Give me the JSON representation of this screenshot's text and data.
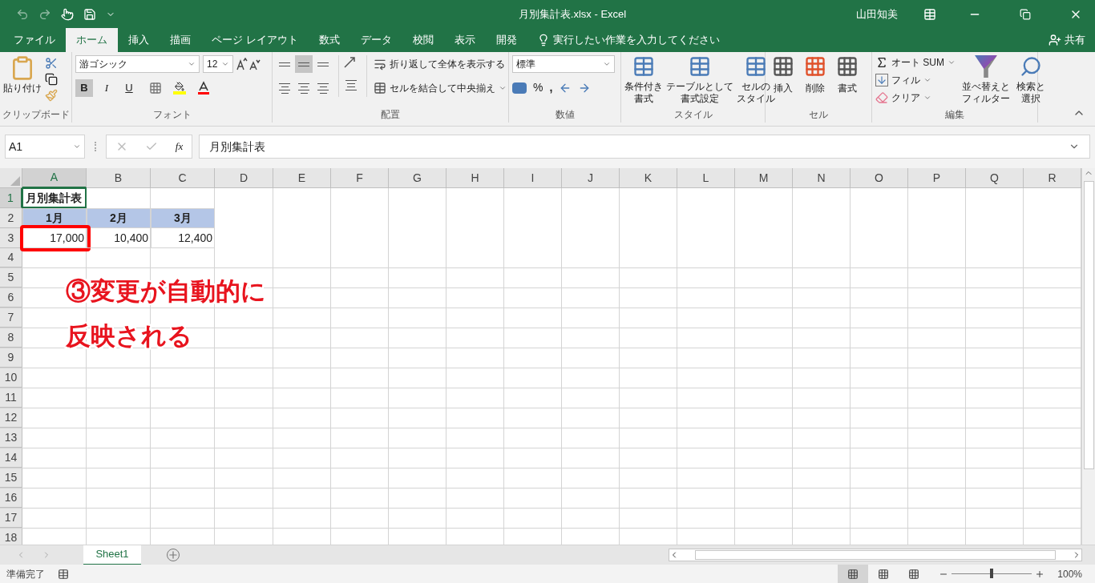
{
  "title_bar": {
    "document": "月別集計表.xlsx - Excel",
    "user": "山田知美"
  },
  "ribbon_tabs": [
    {
      "label": "ファイル",
      "selected": false
    },
    {
      "label": "ホーム",
      "selected": true
    },
    {
      "label": "挿入",
      "selected": false
    },
    {
      "label": "描画",
      "selected": false
    },
    {
      "label": "ページ レイアウト",
      "selected": false
    },
    {
      "label": "数式",
      "selected": false
    },
    {
      "label": "データ",
      "selected": false
    },
    {
      "label": "校閲",
      "selected": false
    },
    {
      "label": "表示",
      "selected": false
    },
    {
      "label": "開発",
      "selected": false
    }
  ],
  "tell_me": {
    "placeholder": "実行したい作業を入力してください"
  },
  "share": "共有",
  "ribbon": {
    "clipboard": {
      "paste": "貼り付け",
      "label": "クリップボード"
    },
    "font": {
      "name": "游ゴシック",
      "size": "12",
      "styles": [
        {
          "label": "B",
          "selected": true
        },
        {
          "label": "I",
          "selected": false
        },
        {
          "label": "U",
          "selected": false
        }
      ],
      "label": "フォント"
    },
    "alignment": {
      "vertical": [
        {
          "selected": false
        },
        {
          "selected": true
        },
        {
          "selected": false
        }
      ],
      "wrap": "折り返して全体を表示する",
      "merge": "セルを結合して中央揃え",
      "label": "配置"
    },
    "number": {
      "format": "標準",
      "percent": "%",
      "comma": ",",
      "label": "数値"
    },
    "styles": {
      "buttons": [
        [
          "条件付き",
          "書式"
        ],
        [
          "テーブルとして",
          "書式設定"
        ],
        [
          "セルの",
          "スタイル"
        ]
      ],
      "label": "スタイル"
    },
    "cells": {
      "buttons": [
        "挿入",
        "削除",
        "書式"
      ],
      "label": "セル"
    },
    "editing": {
      "autosum": "オート SUM",
      "fill": "フィル",
      "clear": "クリア",
      "sort": [
        "並べ替えと",
        "フィルター"
      ],
      "find": [
        "検索と",
        "選択"
      ],
      "label": "編集"
    }
  },
  "formula_bar": {
    "name_box": "A1",
    "function_button": "fx",
    "formula": "月別集計表"
  },
  "columns": [
    {
      "label": "A",
      "selected": true
    },
    {
      "label": "B",
      "selected": false
    },
    {
      "label": "C",
      "selected": false
    },
    {
      "label": "D",
      "selected": false
    },
    {
      "label": "E",
      "selected": false
    },
    {
      "label": "F",
      "selected": false
    },
    {
      "label": "G",
      "selected": false
    },
    {
      "label": "H",
      "selected": false
    },
    {
      "label": "I",
      "selected": false
    },
    {
      "label": "J",
      "selected": false
    },
    {
      "label": "K",
      "selected": false
    },
    {
      "label": "L",
      "selected": false
    },
    {
      "label": "M",
      "selected": false
    },
    {
      "label": "N",
      "selected": false
    },
    {
      "label": "O",
      "selected": false
    },
    {
      "label": "P",
      "selected": false
    },
    {
      "label": "Q",
      "selected": false
    },
    {
      "label": "R",
      "selected": false
    }
  ],
  "rows": [
    {
      "label": "1",
      "selected": true,
      "cells": [
        {
          "text": "月別集計表",
          "kind": "title",
          "selected": true,
          "highlighted": false
        }
      ]
    },
    {
      "label": "2",
      "selected": false,
      "cells": [
        {
          "text": "1月",
          "kind": "header",
          "selected": false,
          "highlighted": false
        },
        {
          "text": "2月",
          "kind": "header",
          "selected": false,
          "highlighted": false
        },
        {
          "text": "3月",
          "kind": "header",
          "selected": false,
          "highlighted": false
        }
      ]
    },
    {
      "label": "3",
      "selected": false,
      "cells": [
        {
          "text": "17,000",
          "kind": "number",
          "selected": false,
          "highlighted": true
        },
        {
          "text": "10,400",
          "kind": "number",
          "selected": false,
          "highlighted": false
        },
        {
          "text": "12,400",
          "kind": "number",
          "selected": false,
          "highlighted": false
        }
      ]
    },
    {
      "label": "4",
      "selected": false
    },
    {
      "label": "5",
      "selected": false
    },
    {
      "label": "6",
      "selected": false
    },
    {
      "label": "7",
      "selected": false
    },
    {
      "label": "8",
      "selected": false
    },
    {
      "label": "9",
      "selected": false
    },
    {
      "label": "10",
      "selected": false
    },
    {
      "label": "11",
      "selected": false
    },
    {
      "label": "12",
      "selected": false
    },
    {
      "label": "13",
      "selected": false
    },
    {
      "label": "14",
      "selected": false
    },
    {
      "label": "15",
      "selected": false
    },
    {
      "label": "16",
      "selected": false
    },
    {
      "label": "17",
      "selected": false
    },
    {
      "label": "18",
      "selected": false
    }
  ],
  "annotation": {
    "lines": [
      "③変更が自動的に",
      "反映される"
    ]
  },
  "sheet_tabs": [
    {
      "label": "Sheet1",
      "selected": true
    }
  ],
  "status_bar": {
    "mode": "準備完了",
    "views": [
      {
        "selected": true
      },
      {
        "selected": false
      },
      {
        "selected": false
      }
    ],
    "zoom": {
      "level": 0.5,
      "reading": "100%"
    }
  }
}
